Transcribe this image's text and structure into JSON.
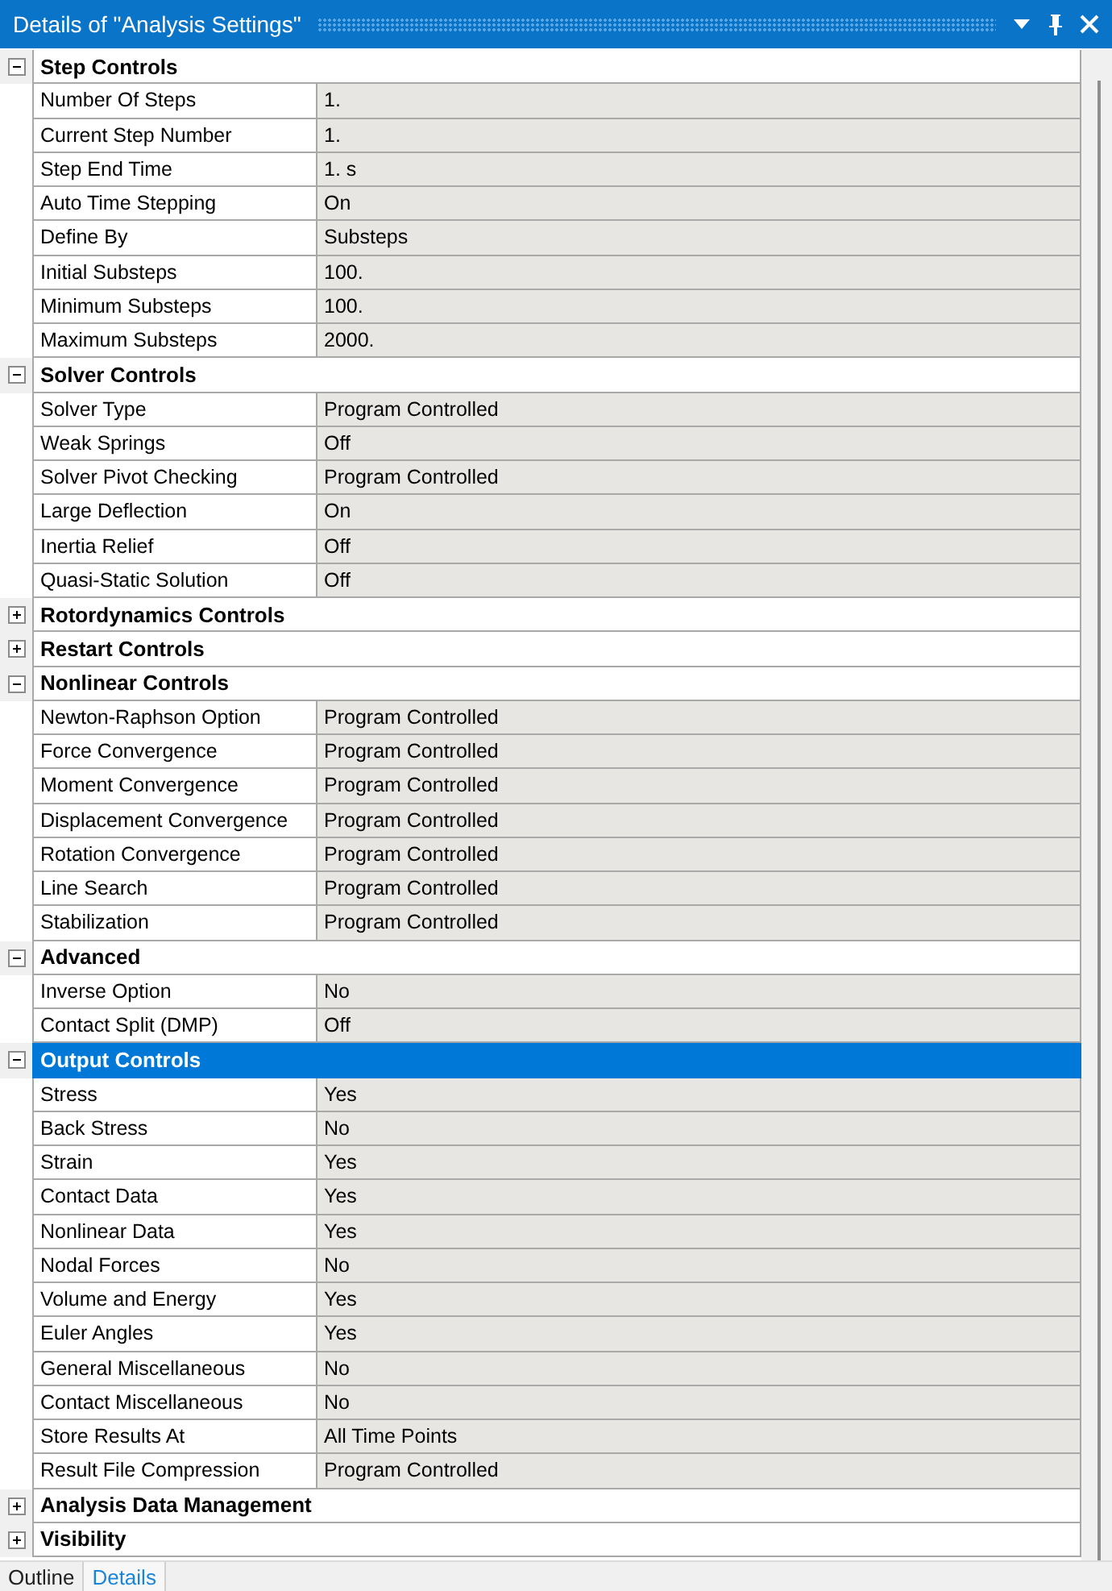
{
  "window": {
    "title": "Details of \"Analysis Settings\""
  },
  "sections": [
    {
      "title": "Step Controls",
      "expanded": true,
      "selected": false,
      "rows": [
        {
          "label": "Number Of Steps",
          "value": "1."
        },
        {
          "label": "Current Step Number",
          "value": "1."
        },
        {
          "label": "Step End Time",
          "value": "1. s"
        },
        {
          "label": "Auto Time Stepping",
          "value": "On"
        },
        {
          "label": "Define By",
          "value": "Substeps"
        },
        {
          "label": "Initial Substeps",
          "value": "100."
        },
        {
          "label": "Minimum Substeps",
          "value": "100."
        },
        {
          "label": "Maximum Substeps",
          "value": "2000."
        }
      ]
    },
    {
      "title": "Solver Controls",
      "expanded": true,
      "selected": false,
      "rows": [
        {
          "label": "Solver Type",
          "value": "Program Controlled"
        },
        {
          "label": "Weak Springs",
          "value": "Off"
        },
        {
          "label": "Solver Pivot Checking",
          "value": "Program Controlled"
        },
        {
          "label": "Large Deflection",
          "value": "On"
        },
        {
          "label": "Inertia Relief",
          "value": "Off"
        },
        {
          "label": "Quasi-Static Solution",
          "value": "Off"
        }
      ]
    },
    {
      "title": "Rotordynamics Controls",
      "expanded": false,
      "selected": false
    },
    {
      "title": "Restart Controls",
      "expanded": false,
      "selected": false
    },
    {
      "title": "Nonlinear Controls",
      "expanded": true,
      "selected": false,
      "rows": [
        {
          "label": "Newton-Raphson Option",
          "value": "Program Controlled"
        },
        {
          "label": "Force Convergence",
          "value": "Program Controlled"
        },
        {
          "label": "Moment Convergence",
          "value": "Program Controlled"
        },
        {
          "label": "Displacement Convergence",
          "value": "Program Controlled"
        },
        {
          "label": "Rotation Convergence",
          "value": "Program Controlled"
        },
        {
          "label": "Line Search",
          "value": "Program Controlled"
        },
        {
          "label": "Stabilization",
          "value": "Program Controlled"
        }
      ]
    },
    {
      "title": "Advanced",
      "expanded": true,
      "selected": false,
      "rows": [
        {
          "label": "Inverse Option",
          "value": "No"
        },
        {
          "label": "Contact Split (DMP)",
          "value": "Off"
        }
      ]
    },
    {
      "title": "Output Controls",
      "expanded": true,
      "selected": true,
      "rows": [
        {
          "label": "Stress",
          "value": "Yes"
        },
        {
          "label": "Back Stress",
          "value": "No"
        },
        {
          "label": "Strain",
          "value": "Yes"
        },
        {
          "label": "Contact Data",
          "value": "Yes"
        },
        {
          "label": "Nonlinear Data",
          "value": "Yes"
        },
        {
          "label": "Nodal Forces",
          "value": "No"
        },
        {
          "label": "Volume and Energy",
          "value": "Yes"
        },
        {
          "label": "Euler Angles",
          "value": "Yes"
        },
        {
          "label": "General Miscellaneous",
          "value": "No"
        },
        {
          "label": "Contact Miscellaneous",
          "value": "No"
        },
        {
          "label": "Store Results At",
          "value": "All Time Points"
        },
        {
          "label": "Result File Compression",
          "value": "Program Controlled"
        }
      ]
    },
    {
      "title": "Analysis Data Management",
      "expanded": false,
      "selected": false
    },
    {
      "title": "Visibility",
      "expanded": false,
      "selected": false
    }
  ],
  "tabs": [
    {
      "label": "Outline",
      "selected": false
    },
    {
      "label": "Details",
      "selected": true
    }
  ]
}
